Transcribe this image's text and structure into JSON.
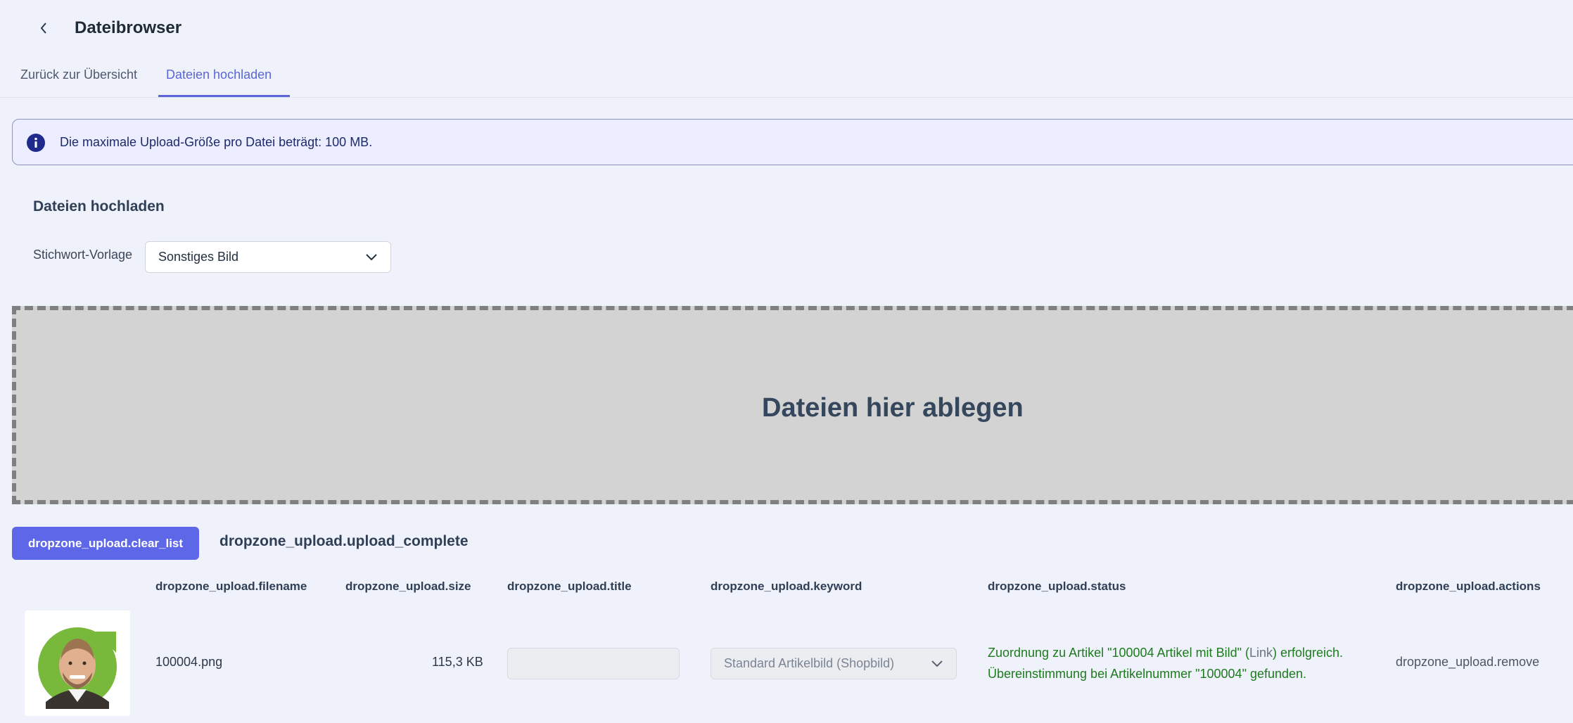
{
  "header": {
    "title": "Dateibrowser"
  },
  "tabs": [
    {
      "label": "Zurück zur Übersicht",
      "active": false
    },
    {
      "label": "Dateien hochladen",
      "active": true
    }
  ],
  "info_banner": {
    "icon": "info-icon",
    "text": "Die maximale Upload-Größe pro Datei beträgt: 100 MB."
  },
  "upload_section": {
    "title": "Dateien hochladen",
    "keyword_label": "Stichwort-Vorlage",
    "keyword_selected": "Sonstiges Bild",
    "dropzone_text": "Dateien hier ablegen",
    "clear_button": "dropzone_upload.clear_list",
    "status_heading": "dropzone_upload.upload_complete"
  },
  "table": {
    "headers": {
      "filename": "dropzone_upload.filename",
      "size": "dropzone_upload.size",
      "title": "dropzone_upload.title",
      "keyword": "dropzone_upload.keyword",
      "status": "dropzone_upload.status",
      "actions": "dropzone_upload.actions"
    },
    "rows": [
      {
        "thumbnail": "person-photo",
        "filename": "100004.png",
        "size": "115,3 KB",
        "title": "",
        "keyword": "Standard Artikelbild (Shopbild)",
        "status_line1_pre": "Zuordnung zu Artikel \"100004 Artikel mit Bild\" (",
        "status_link": "Link",
        "status_line1_post": ") erfolgreich.",
        "status_line2": "Übereinstimmung bei Artikelnummer \"100004\" gefunden.",
        "action": "dropzone_upload.remove"
      }
    ]
  },
  "colors": {
    "accent": "#5a66d6",
    "button": "#5d67e8",
    "success": "#1d7a1d",
    "info_bg": "#eceeff",
    "dropzone_bg": "#d3d3d3"
  }
}
